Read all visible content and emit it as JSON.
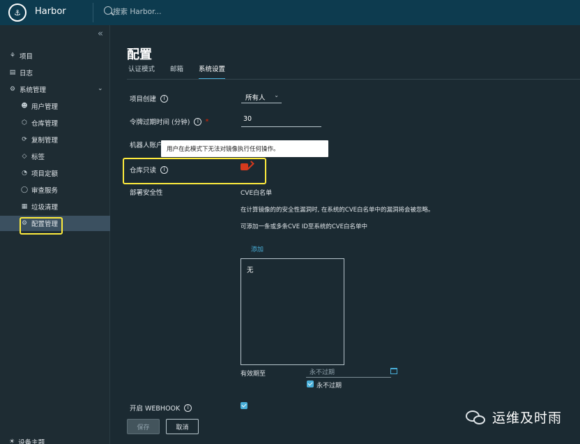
{
  "header": {
    "logo_glyph": "⚓",
    "brand": "Harbor",
    "search_placeholder": "搜索 Harbor..."
  },
  "sidebar": {
    "collapse_glyph": "«",
    "items": [
      {
        "label": "项目",
        "icon": "projects-icon"
      },
      {
        "label": "日志",
        "icon": "logs-icon"
      },
      {
        "label": "系统管理",
        "icon": "admin-icon"
      }
    ],
    "admin_children": [
      {
        "label": "用户管理",
        "icon": "users-icon"
      },
      {
        "label": "仓库管理",
        "icon": "registry-icon"
      },
      {
        "label": "复制管理",
        "icon": "replication-icon"
      },
      {
        "label": "标签",
        "icon": "tag-icon"
      },
      {
        "label": "项目定额",
        "icon": "quota-icon"
      },
      {
        "label": "审查服务",
        "icon": "shield-icon"
      },
      {
        "label": "垃圾清理",
        "icon": "trash-icon"
      },
      {
        "label": "配置管理",
        "icon": "gear-icon"
      }
    ],
    "bottom_item": "设备主题"
  },
  "main": {
    "title": "配置",
    "tabs": [
      "认证模式",
      "邮箱",
      "系统设置"
    ],
    "active_tab": "系统设置",
    "fields": {
      "project_creation_label": "项目创建",
      "project_creation_value": "所有人",
      "token_expiry_label": "令牌过期时间 (分钟)",
      "token_expiry_value": "30",
      "robot_account_label": "机器人账户",
      "repo_readonly_label": "仓库只读",
      "tooltip_text": "用户在此模式下无法对镜像执行任何操作。",
      "deploy_security_label": "部署安全性",
      "cve_whitelist_title": "CVE白名单",
      "cve_desc1": "在计算镜像的的安全性漏洞时, 在系统的CVE白名单中的漏洞将会被忽略。",
      "cve_desc2": "可添加一条或多条CVE ID至系统的CVE白名单中",
      "add_link": "添加",
      "whitelist_empty": "无",
      "expire_label": "有效期至",
      "expire_placeholder": "永不过期",
      "never_expire_label": "永不过期",
      "webhook_label": "开启 WEBHOOK"
    },
    "buttons": {
      "save": "保存",
      "cancel": "取消"
    }
  },
  "watermark": "运维及时雨",
  "colors": {
    "header": "#0d3b4f",
    "accent": "#49afd9",
    "highlight": "#ffec3d",
    "background": "#1b2a32"
  }
}
